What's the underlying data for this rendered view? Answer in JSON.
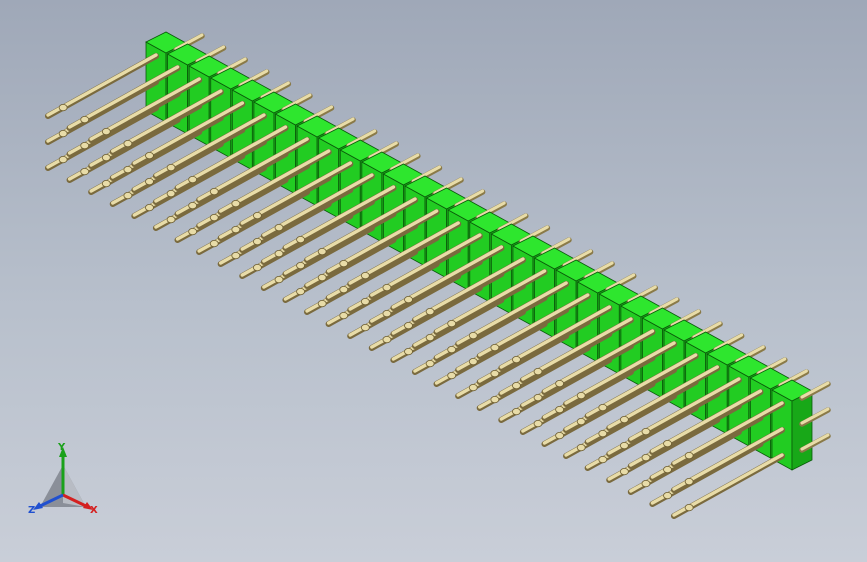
{
  "model": {
    "pin_rows": 3,
    "pin_columns": 30,
    "housing_color": "#2ee62e",
    "pin_color": "#e8dca8"
  },
  "triad": {
    "y_label": "Y",
    "x_label": "X",
    "z_label": "Z",
    "y_color": "#1aa11a",
    "x_color": "#d42020",
    "z_color": "#2050d0"
  }
}
